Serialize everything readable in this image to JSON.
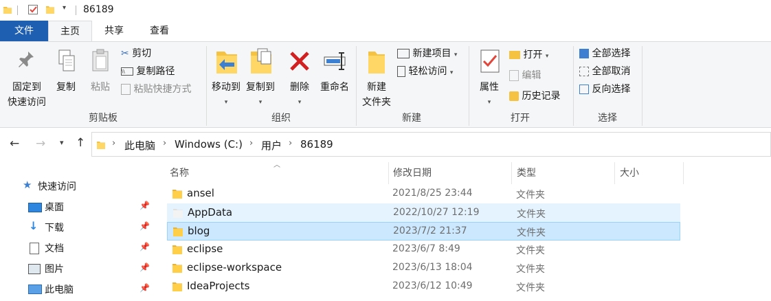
{
  "window": {
    "path_title": "86189"
  },
  "ribbon_tabs": [
    {
      "label": "文件"
    },
    {
      "label": "主页"
    },
    {
      "label": "共享"
    },
    {
      "label": "查看"
    }
  ],
  "clipboard": {
    "pin_label_1": "固定到",
    "pin_label_2": "快速访问",
    "copy_label": "复制",
    "paste_label": "粘贴",
    "cut_label": "剪切",
    "copy_path_label": "复制路径",
    "paste_shortcut_label": "粘贴快捷方式",
    "group_label": "剪贴板"
  },
  "organize": {
    "move_to_label": "移动到",
    "copy_to_label": "复制到",
    "delete_label": "删除",
    "rename_label": "重命名",
    "group_label": "组织"
  },
  "new": {
    "new_folder_label_1": "新建",
    "new_folder_label_2": "文件夹",
    "new_item_label": "新建项目",
    "easy_access_label": "轻松访问",
    "group_label": "新建"
  },
  "open": {
    "properties_label": "属性",
    "open_label": "打开",
    "edit_label": "编辑",
    "history_label": "历史记录",
    "group_label": "打开"
  },
  "select": {
    "select_all_label": "全部选择",
    "select_none_label": "全部取消",
    "invert_label": "反向选择",
    "group_label": "选择"
  },
  "breadcrumb": [
    "此电脑",
    "Windows (C:)",
    "用户",
    "86189"
  ],
  "nav": [
    {
      "label": "快速访问"
    },
    {
      "label": "桌面"
    },
    {
      "label": "下载"
    },
    {
      "label": "文档"
    },
    {
      "label": "图片"
    },
    {
      "label": "此电脑"
    }
  ],
  "columns": {
    "name": "名称",
    "modified": "修改日期",
    "type": "类型",
    "size": "大小"
  },
  "files": [
    {
      "name": "ansel",
      "modified": "2021/8/25 23:44",
      "type": "文件夹"
    },
    {
      "name": "AppData",
      "modified": "2022/10/27 12:19",
      "type": "文件夹"
    },
    {
      "name": "blog",
      "modified": "2023/7/2 21:37",
      "type": "文件夹"
    },
    {
      "name": "eclipse",
      "modified": "2023/6/7 8:49",
      "type": "文件夹"
    },
    {
      "name": "eclipse-workspace",
      "modified": "2023/6/13 18:04",
      "type": "文件夹"
    },
    {
      "name": "IdeaProjects",
      "modified": "2023/6/12 10:49",
      "type": "文件夹"
    }
  ],
  "colors": {
    "accent": "#1f5fb1",
    "selected_row": "#cce8ff",
    "hover_row": "#e5f3ff",
    "folder": "#f5c242"
  }
}
